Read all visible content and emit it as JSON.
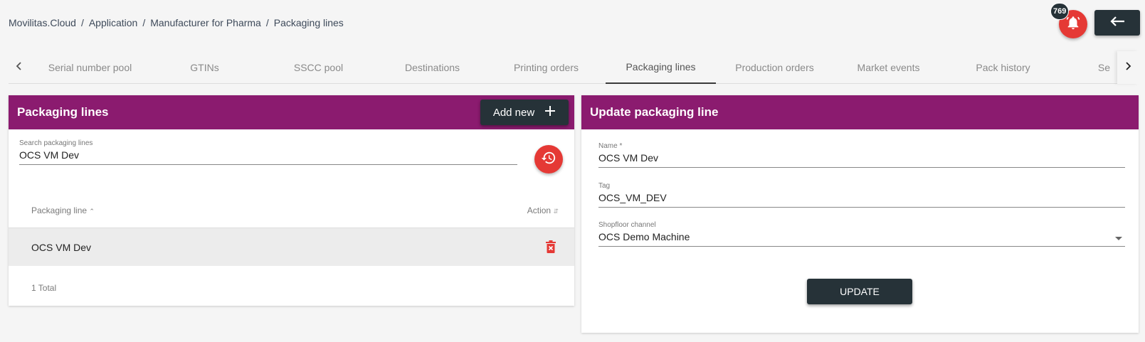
{
  "breadcrumb": {
    "items": [
      "Movilitas.Cloud",
      "Application",
      "Manufacturer for Pharma",
      "Packaging lines"
    ],
    "separator": "/"
  },
  "header": {
    "notification_count": "769",
    "bell_icon": "bell-alert-icon",
    "back_icon": "arrow-left-icon"
  },
  "tabs": {
    "items": [
      "Serial number pool",
      "GTINs",
      "SSCC pool",
      "Destinations",
      "Printing orders",
      "Packaging lines",
      "Production orders",
      "Market events",
      "Pack history",
      "Se"
    ],
    "active": "Packaging lines"
  },
  "list_panel": {
    "title": "Packaging lines",
    "add_new_label": "Add new",
    "search": {
      "label": "Search packaging lines",
      "value": "OCS VM Dev"
    },
    "columns": {
      "packaging_line": "Packaging line",
      "action": "Action"
    },
    "rows": [
      {
        "name": "OCS VM Dev"
      }
    ],
    "total": "1 Total"
  },
  "edit_panel": {
    "title": "Update packaging line",
    "name_label": "Name *",
    "name_value": "OCS VM Dev",
    "tag_label": "Tag",
    "tag_value": "OCS_VM_DEV",
    "channel_label": "Shopfloor channel",
    "channel_value": "OCS Demo Machine",
    "update_label": "UPDATE"
  },
  "colors": {
    "header_purple": "#8b1b6f",
    "dark_button": "#263238",
    "accent_red": "#e53935"
  }
}
